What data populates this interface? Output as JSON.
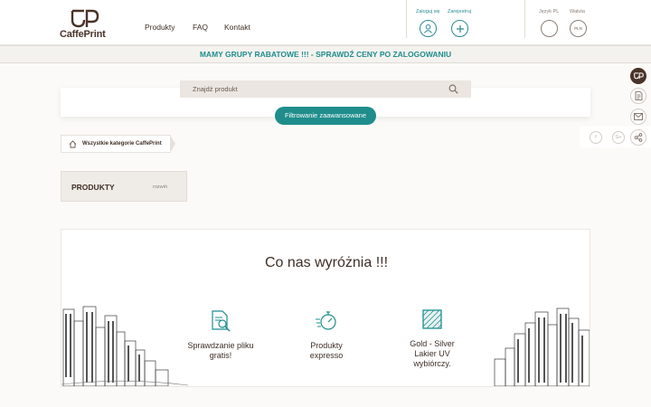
{
  "header": {
    "logo_text": "CaffePrint",
    "nav": [
      "Produkty",
      "FAQ",
      "Kontakt"
    ],
    "login_label": "Zaloguj się",
    "register_label": "Zarejestruj",
    "language_label": "Język PL",
    "currency_label": "Waluta",
    "currency_value": "PLN"
  },
  "banner": {
    "text": "MAMY GRUPY RABATOWE !!! - SPRAWDŹ CENY PO ZALOGOWANIU"
  },
  "search": {
    "placeholder": "Znajdź produkt",
    "filter_button": "Filtrowanie zaawansowane"
  },
  "breadcrumb": {
    "label": "Wszystkie kategorie CaffePrint"
  },
  "products_panel": {
    "title": "PRODUKTY",
    "toggle": "rozwiń"
  },
  "features": {
    "title": "Co nas wyróżnia !!!",
    "items": [
      {
        "line1": "Sprawdzanie pliku",
        "line2": "gratis!",
        "line3": "",
        "icon": "file-check-icon"
      },
      {
        "line1": "Produkty",
        "line2": "expresso",
        "line3": "",
        "icon": "stopwatch-icon"
      },
      {
        "line1": "Gold - Silver",
        "line2": "Lakier UV",
        "line3": "wybiórczy.",
        "icon": "varnish-icon"
      }
    ]
  },
  "colors": {
    "accent": "#1f8d8c",
    "brand": "#4a3328",
    "panel": "#efebe7"
  }
}
